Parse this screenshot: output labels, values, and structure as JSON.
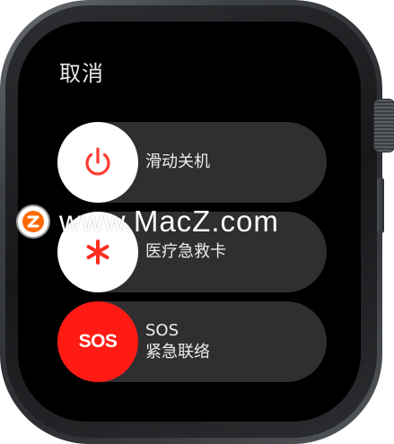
{
  "screen": {
    "cancel_label": "取消",
    "sliders": [
      {
        "label": "滑动关机",
        "icon": "power-icon",
        "accent": "#ff3b30"
      },
      {
        "label": "医疗急救卡",
        "icon": "medical-asterisk-icon",
        "accent": "#ff2d20"
      },
      {
        "badge": "SOS",
        "label_line1": "SOS",
        "label_line2": "紧急联络",
        "accent": "#ff1b14"
      }
    ]
  },
  "watermark": {
    "text": "www.MacZ.com",
    "logo_letter": "Z",
    "logo_color": "#ff6a00"
  }
}
